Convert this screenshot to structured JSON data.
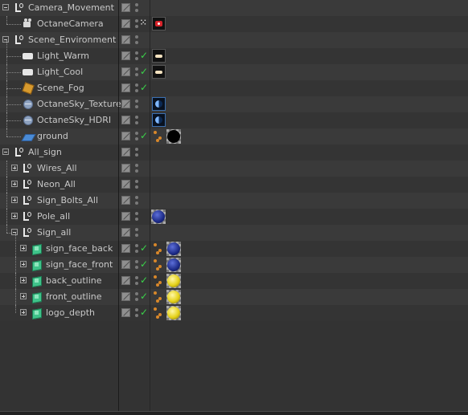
{
  "objects": [
    {
      "label": "Camera_Movement",
      "icon": "null-icon",
      "tags": []
    },
    {
      "label": "OctaneCamera",
      "icon": "camera-icon",
      "tags": [
        "octane-camera-tag"
      ]
    },
    {
      "label": "Scene_Environment",
      "icon": "null-icon",
      "tags": []
    },
    {
      "label": "Light_Warm",
      "icon": "area-light-icon",
      "tags": [
        "octane-light-tag"
      ]
    },
    {
      "label": "Light_Cool",
      "icon": "area-light-icon",
      "tags": [
        "octane-light-tag"
      ]
    },
    {
      "label": "Scene_Fog",
      "icon": "fog-object-icon",
      "tags": []
    },
    {
      "label": "OctaneSky_Texture",
      "icon": "sky-object-icon",
      "tags": [
        "octane-environment-tag"
      ]
    },
    {
      "label": "OctaneSky_HDRI",
      "icon": "sky-object-icon",
      "tags": [
        "octane-environment-tag"
      ]
    },
    {
      "label": "ground",
      "icon": "plane-object-icon",
      "tags": [
        "phong-tag",
        "material-tag-black"
      ]
    },
    {
      "label": "All_sign",
      "icon": "null-icon",
      "tags": []
    },
    {
      "label": "Wires_All",
      "icon": "null-icon",
      "tags": []
    },
    {
      "label": "Neon_All",
      "icon": "null-icon",
      "tags": []
    },
    {
      "label": "Sign_Bolts_All",
      "icon": "null-icon",
      "tags": []
    },
    {
      "label": "Pole_all",
      "icon": "null-icon",
      "tags": [
        "material-tag-blue"
      ]
    },
    {
      "label": "Sign_all",
      "icon": "null-icon",
      "tags": []
    },
    {
      "label": "sign_face_back",
      "icon": "polygon-object-icon",
      "tags": [
        "phong-tag",
        "material-tag-blue"
      ]
    },
    {
      "label": "sign_face_front",
      "icon": "polygon-object-icon",
      "tags": [
        "phong-tag",
        "material-tag-blue"
      ]
    },
    {
      "label": "back_outline",
      "icon": "polygon-object-icon",
      "tags": [
        "phong-tag",
        "material-tag-yellow"
      ]
    },
    {
      "label": "front_outline",
      "icon": "polygon-object-icon",
      "tags": [
        "phong-tag",
        "material-tag-yellow"
      ]
    },
    {
      "label": "logo_depth",
      "icon": "polygon-object-icon",
      "tags": [
        "phong-tag",
        "material-tag-yellow"
      ]
    }
  ],
  "colors": {
    "background": "#333333",
    "row_alt": "#3a3a3a",
    "check": "#3bd24a",
    "camera_tag": "#d8232a"
  }
}
